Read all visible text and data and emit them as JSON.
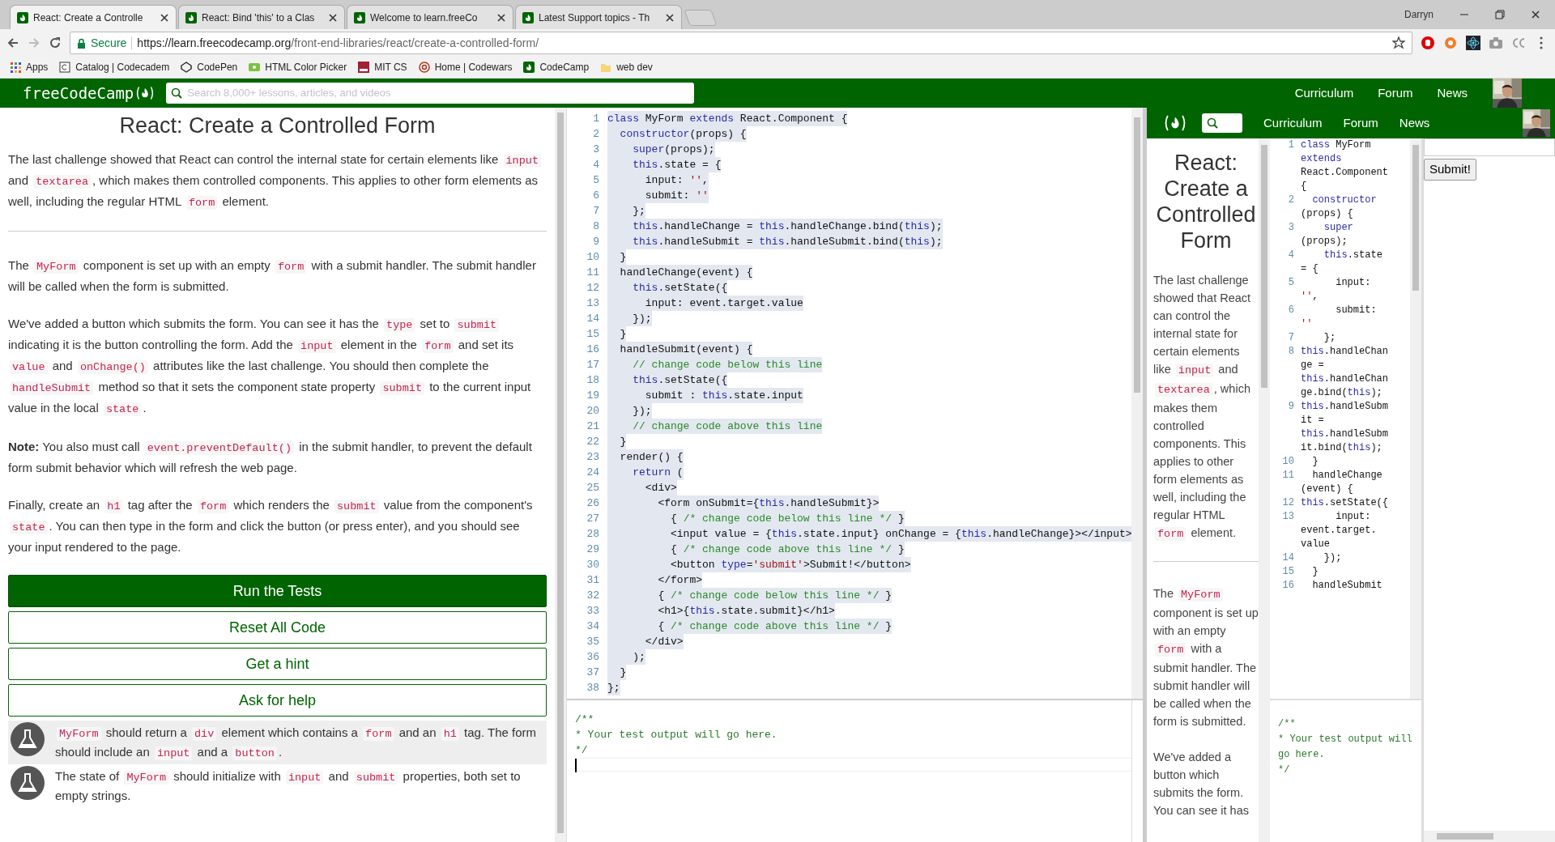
{
  "browser": {
    "tabs": [
      {
        "title": "React: Create a Controlle",
        "selected": true
      },
      {
        "title": "React: Bind 'this' to a Clas",
        "selected": false
      },
      {
        "title": "Welcome to learn.freeCo",
        "selected": false
      },
      {
        "title": "Latest Support topics - Th",
        "selected": false
      }
    ],
    "profile": "Darryn",
    "security": "Secure",
    "url": {
      "host": "https://learn.freecodecamp.org",
      "path": "/front-end-libraries/react/create-a-controlled-form/"
    },
    "bookmarks": [
      {
        "label": "Apps",
        "kind": "apps"
      },
      {
        "label": "Catalog | Codecadem",
        "kind": "codecademy"
      },
      {
        "label": "CodePen",
        "kind": "codepen"
      },
      {
        "label": "HTML Color Picker",
        "kind": "colorpicker"
      },
      {
        "label": "MIT CS",
        "kind": "mit"
      },
      {
        "label": "Home | Codewars",
        "kind": "codewars"
      },
      {
        "label": "CodeCamp",
        "kind": "fcc"
      },
      {
        "label": "web dev",
        "kind": "folder"
      }
    ]
  },
  "site_nav": {
    "logo": "freeCodeCamp",
    "search_placeholder": "Search 8,000+ lessons, articles, and videos",
    "links": [
      "Curriculum",
      "Forum",
      "News"
    ]
  },
  "challenge": {
    "title": "React: Create a Controlled Form",
    "blocks": [
      {
        "kind": "paragraph",
        "segments": [
          {
            "kind": "text",
            "text": "The last challenge showed that React can control the internal state for certain elements like "
          },
          {
            "kind": "code",
            "text": "input"
          },
          {
            "kind": "text",
            "text": " and "
          },
          {
            "kind": "code",
            "text": "textarea"
          },
          {
            "kind": "text",
            "text": ", which makes them controlled components. This applies to other form elements as well, including the regular HTML "
          },
          {
            "kind": "code",
            "text": "form"
          },
          {
            "kind": "text",
            "text": " element."
          }
        ]
      },
      {
        "kind": "divider"
      },
      {
        "kind": "paragraph",
        "segments": [
          {
            "kind": "text",
            "text": "The "
          },
          {
            "kind": "code",
            "text": "MyForm"
          },
          {
            "kind": "text",
            "text": " component is set up with an empty "
          },
          {
            "kind": "code",
            "text": "form"
          },
          {
            "kind": "text",
            "text": " with a submit handler. The submit handler will be called when the form is submitted."
          }
        ]
      },
      {
        "kind": "paragraph",
        "segments": [
          {
            "kind": "text",
            "text": "We've added a button which submits the form. You can see it has the "
          },
          {
            "kind": "code",
            "text": "type"
          },
          {
            "kind": "text",
            "text": " set to "
          },
          {
            "kind": "code",
            "text": "submit"
          },
          {
            "kind": "text",
            "text": " indicating it is the button controlling the form. Add the "
          },
          {
            "kind": "code",
            "text": "input"
          },
          {
            "kind": "text",
            "text": " element in the "
          },
          {
            "kind": "code",
            "text": "form"
          },
          {
            "kind": "text",
            "text": " and set its "
          },
          {
            "kind": "code",
            "text": "value"
          },
          {
            "kind": "text",
            "text": " and "
          },
          {
            "kind": "code",
            "text": "onChange()"
          },
          {
            "kind": "text",
            "text": " attributes like the last challenge. You should then complete the "
          },
          {
            "kind": "code",
            "text": "handleSubmit"
          },
          {
            "kind": "text",
            "text": " method so that it sets the component state property "
          },
          {
            "kind": "code",
            "text": "submit"
          },
          {
            "kind": "text",
            "text": " to the current input value in the local "
          },
          {
            "kind": "code",
            "text": "state"
          },
          {
            "kind": "text",
            "text": "."
          }
        ]
      },
      {
        "kind": "paragraph",
        "segments": [
          {
            "kind": "text",
            "text": "**Note:**  You also must call "
          },
          {
            "kind": "code",
            "text": "event.preventDefault()"
          },
          {
            "kind": "text",
            "text": " in the submit handler, to prevent the default form submit behavior which will refresh the web page."
          }
        ]
      },
      {
        "kind": "paragraph",
        "segments": [
          {
            "kind": "text",
            "text": "Finally, create an "
          },
          {
            "kind": "code",
            "text": "h1"
          },
          {
            "kind": "text",
            "text": " tag after the "
          },
          {
            "kind": "code",
            "text": "form"
          },
          {
            "kind": "text",
            "text": " which renders the "
          },
          {
            "kind": "code",
            "text": "submit"
          },
          {
            "kind": "text",
            "text": " value from the component's "
          },
          {
            "kind": "code",
            "text": "state"
          },
          {
            "kind": "text",
            "text": ". You can then type in the form and click the button (or press enter), and you should see your input rendered to the page."
          }
        ]
      }
    ],
    "buttons": [
      {
        "label": "Run the Tests",
        "kind": "primary"
      },
      {
        "label": "Reset All Code",
        "kind": "outline"
      },
      {
        "label": "Get a hint",
        "kind": "outline"
      },
      {
        "label": "Ask for help",
        "kind": "outline"
      }
    ],
    "tests": [
      {
        "shaded": true,
        "segments": [
          {
            "kind": "code",
            "text": "MyForm"
          },
          {
            "kind": "text",
            "text": " should return a "
          },
          {
            "kind": "code",
            "text": "div"
          },
          {
            "kind": "text",
            "text": " element which contains a "
          },
          {
            "kind": "code",
            "text": "form"
          },
          {
            "kind": "text",
            "text": " and an "
          },
          {
            "kind": "code",
            "text": "h1"
          },
          {
            "kind": "text",
            "text": " tag. The form should include an "
          },
          {
            "kind": "code",
            "text": "input"
          },
          {
            "kind": "text",
            "text": " and a "
          },
          {
            "kind": "code",
            "text": "button"
          },
          {
            "kind": "text",
            "text": "."
          }
        ]
      },
      {
        "shaded": false,
        "segments": [
          {
            "kind": "text",
            "text": "The state of "
          },
          {
            "kind": "code",
            "text": "MyForm"
          },
          {
            "kind": "text",
            "text": " should initialize with "
          },
          {
            "kind": "code",
            "text": "input"
          },
          {
            "kind": "text",
            "text": " and "
          },
          {
            "kind": "code",
            "text": "submit"
          },
          {
            "kind": "text",
            "text": " properties, both set to empty strings."
          }
        ]
      }
    ]
  },
  "editor": {
    "selected": true,
    "lines": [
      {
        "number": "1",
        "tokens": [
          {
            "kind": "keyword",
            "text": "class"
          },
          {
            "kind": "plain",
            "text": " MyForm "
          },
          {
            "kind": "keyword",
            "text": "extends"
          },
          {
            "kind": "plain",
            "text": " React.Component {"
          }
        ]
      },
      {
        "number": "2",
        "tokens": [
          {
            "kind": "keyword",
            "text": "  constructor"
          },
          {
            "kind": "plain",
            "text": "(props) {"
          }
        ]
      },
      {
        "number": "3",
        "tokens": [
          {
            "kind": "keyword",
            "text": "    super"
          },
          {
            "kind": "plain",
            "text": "(props);"
          }
        ]
      },
      {
        "number": "4",
        "tokens": [
          {
            "kind": "keyword",
            "text": "    this"
          },
          {
            "kind": "plain",
            "text": ".state = {"
          }
        ]
      },
      {
        "number": "5",
        "tokens": [
          {
            "kind": "plain",
            "text": "      input: "
          },
          {
            "kind": "string",
            "text": "''"
          },
          {
            "kind": "plain",
            "text": ","
          }
        ]
      },
      {
        "number": "6",
        "tokens": [
          {
            "kind": "plain",
            "text": "      submit: "
          },
          {
            "kind": "string",
            "text": "''"
          }
        ]
      },
      {
        "number": "7",
        "tokens": [
          {
            "kind": "plain",
            "text": "    };"
          }
        ]
      },
      {
        "number": "8",
        "tokens": [
          {
            "kind": "keyword",
            "text": "    this"
          },
          {
            "kind": "plain",
            "text": ".handleChange = "
          },
          {
            "kind": "keyword",
            "text": "this"
          },
          {
            "kind": "plain",
            "text": ".handleChange.bind("
          },
          {
            "kind": "keyword",
            "text": "this"
          },
          {
            "kind": "plain",
            "text": ");"
          }
        ]
      },
      {
        "number": "9",
        "tokens": [
          {
            "kind": "keyword",
            "text": "    this"
          },
          {
            "kind": "plain",
            "text": ".handleSubmit = "
          },
          {
            "kind": "keyword",
            "text": "this"
          },
          {
            "kind": "plain",
            "text": ".handleSubmit.bind("
          },
          {
            "kind": "keyword",
            "text": "this"
          },
          {
            "kind": "plain",
            "text": ");"
          }
        ]
      },
      {
        "number": "10",
        "tokens": [
          {
            "kind": "plain",
            "text": "  }"
          }
        ]
      },
      {
        "number": "11",
        "tokens": [
          {
            "kind": "plain",
            "text": "  handleChange(event) {"
          }
        ]
      },
      {
        "number": "12",
        "tokens": [
          {
            "kind": "keyword",
            "text": "    this"
          },
          {
            "kind": "plain",
            "text": ".setState({"
          }
        ]
      },
      {
        "number": "13",
        "tokens": [
          {
            "kind": "plain",
            "text": "      input: event.target.value"
          }
        ]
      },
      {
        "number": "14",
        "tokens": [
          {
            "kind": "plain",
            "text": "    });"
          }
        ]
      },
      {
        "number": "15",
        "tokens": [
          {
            "kind": "plain",
            "text": "  }"
          }
        ]
      },
      {
        "number": "16",
        "tokens": [
          {
            "kind": "plain",
            "text": "  handleSubmit(event) {"
          }
        ]
      },
      {
        "number": "17",
        "tokens": [
          {
            "kind": "comment",
            "text": "    // change code below this line"
          }
        ]
      },
      {
        "number": "18",
        "tokens": [
          {
            "kind": "keyword",
            "text": "    this"
          },
          {
            "kind": "plain",
            "text": ".setState({"
          }
        ]
      },
      {
        "number": "19",
        "tokens": [
          {
            "kind": "plain",
            "text": "      submit : "
          },
          {
            "kind": "keyword",
            "text": "this"
          },
          {
            "kind": "plain",
            "text": ".state.input"
          }
        ]
      },
      {
        "number": "20",
        "tokens": [
          {
            "kind": "plain",
            "text": "    });"
          }
        ]
      },
      {
        "number": "21",
        "tokens": [
          {
            "kind": "comment",
            "text": "    // change code above this line"
          }
        ]
      },
      {
        "number": "22",
        "tokens": [
          {
            "kind": "plain",
            "text": "  }"
          }
        ]
      },
      {
        "number": "23",
        "tokens": [
          {
            "kind": "plain",
            "text": "  render() {"
          }
        ]
      },
      {
        "number": "24",
        "tokens": [
          {
            "kind": "keyword",
            "text": "    return"
          },
          {
            "kind": "plain",
            "text": " ("
          }
        ]
      },
      {
        "number": "25",
        "tokens": [
          {
            "kind": "plain",
            "text": "      <div>"
          }
        ]
      },
      {
        "number": "26",
        "tokens": [
          {
            "kind": "plain",
            "text": "        <form onSubmit={"
          },
          {
            "kind": "keyword",
            "text": "this"
          },
          {
            "kind": "plain",
            "text": ".handleSubmit}>"
          }
        ]
      },
      {
        "number": "27",
        "tokens": [
          {
            "kind": "plain",
            "text": "          { "
          },
          {
            "kind": "comment",
            "text": "/* change code below this line */"
          },
          {
            "kind": "plain",
            "text": " }"
          }
        ]
      },
      {
        "number": "28",
        "tokens": [
          {
            "kind": "plain",
            "text": "          <input value = {"
          },
          {
            "kind": "keyword",
            "text": "this"
          },
          {
            "kind": "plain",
            "text": ".state.input} onChange = {"
          },
          {
            "kind": "keyword",
            "text": "this"
          },
          {
            "kind": "plain",
            "text": ".handleChange}></input>"
          }
        ]
      },
      {
        "number": "29",
        "tokens": [
          {
            "kind": "plain",
            "text": "          { "
          },
          {
            "kind": "comment",
            "text": "/* change code above this line */"
          },
          {
            "kind": "plain",
            "text": " }"
          }
        ]
      },
      {
        "number": "30",
        "tokens": [
          {
            "kind": "plain",
            "text": "          <button "
          },
          {
            "kind": "keyword",
            "text": "type"
          },
          {
            "kind": "plain",
            "text": "="
          },
          {
            "kind": "string",
            "text": "'submit'"
          },
          {
            "kind": "plain",
            "text": ">Submit!</button>"
          }
        ]
      },
      {
        "number": "31",
        "tokens": [
          {
            "kind": "plain",
            "text": "        </form>"
          }
        ]
      },
      {
        "number": "32",
        "tokens": [
          {
            "kind": "plain",
            "text": "        { "
          },
          {
            "kind": "comment",
            "text": "/* change code below this line */"
          },
          {
            "kind": "plain",
            "text": " }"
          }
        ]
      },
      {
        "number": "33",
        "tokens": [
          {
            "kind": "plain",
            "text": "        <h1>{"
          },
          {
            "kind": "keyword",
            "text": "this"
          },
          {
            "kind": "plain",
            "text": ".state.submit}</h1>"
          }
        ]
      },
      {
        "number": "34",
        "tokens": [
          {
            "kind": "plain",
            "text": "        { "
          },
          {
            "kind": "comment",
            "text": "/* change code above this line */"
          },
          {
            "kind": "plain",
            "text": " }"
          }
        ]
      },
      {
        "number": "35",
        "tokens": [
          {
            "kind": "plain",
            "text": "      </div>"
          }
        ]
      },
      {
        "number": "36",
        "tokens": [
          {
            "kind": "plain",
            "text": "    );"
          }
        ]
      },
      {
        "number": "37",
        "tokens": [
          {
            "kind": "plain",
            "text": "  }"
          }
        ]
      },
      {
        "number": "38",
        "tokens": [
          {
            "kind": "plain",
            "text": "};"
          }
        ]
      }
    ]
  },
  "output": {
    "lines": [
      "/**",
      "* Your test output will go here.",
      "*/"
    ]
  },
  "preview": {
    "nav_links": [
      "Curriculum",
      "Forum",
      "News"
    ],
    "title": "React: Create a Controlled Form",
    "blocks": [
      {
        "kind": "paragraph",
        "segments": [
          {
            "kind": "text",
            "text": "The last challenge showed that React can control the internal state for certain elements like "
          },
          {
            "kind": "code",
            "text": "input"
          },
          {
            "kind": "text",
            "text": " and "
          },
          {
            "kind": "code",
            "text": "textarea"
          },
          {
            "kind": "text",
            "text": ", which makes them controlled components. This applies to other form elements as well, including the regular HTML "
          },
          {
            "kind": "code",
            "text": "form"
          },
          {
            "kind": "text",
            "text": " element."
          }
        ]
      },
      {
        "kind": "divider"
      },
      {
        "kind": "paragraph",
        "segments": [
          {
            "kind": "text",
            "text": "The "
          },
          {
            "kind": "code",
            "text": "MyForm"
          },
          {
            "kind": "text",
            "text": " component is set up with an empty "
          },
          {
            "kind": "code",
            "text": "form"
          },
          {
            "kind": "text",
            "text": " with a submit handler. The submit handler will be called when the form is submitted."
          }
        ]
      },
      {
        "kind": "paragraph",
        "segments": [
          {
            "kind": "text",
            "text": "We've added a button which submits the form. You can see it has"
          }
        ]
      }
    ],
    "code_lines": [
      {
        "number": "1",
        "tokens": [
          {
            "kind": "keyword",
            "text": "class"
          },
          {
            "kind": "plain",
            "text": " MyForm "
          },
          {
            "kind": "keyword",
            "text": "extends"
          },
          {
            "kind": "plain",
            "text": " React.Component {"
          }
        ]
      },
      {
        "number": "2",
        "tokens": [
          {
            "kind": "keyword",
            "text": "  constructor"
          },
          {
            "kind": "plain",
            "text": " (props) {"
          }
        ]
      },
      {
        "number": "3",
        "tokens": [
          {
            "kind": "keyword",
            "text": "    super"
          },
          {
            "kind": "plain",
            "text": " (props);"
          }
        ]
      },
      {
        "number": "4",
        "tokens": [
          {
            "kind": "keyword",
            "text": "    this"
          },
          {
            "kind": "plain",
            "text": ".state = {"
          }
        ]
      },
      {
        "number": "5",
        "tokens": [
          {
            "kind": "plain",
            "text": "      input: "
          },
          {
            "kind": "string",
            "text": "''"
          },
          {
            "kind": "plain",
            "text": ","
          }
        ]
      },
      {
        "number": "6",
        "tokens": [
          {
            "kind": "plain",
            "text": "      submit: "
          },
          {
            "kind": "string",
            "text": "''"
          }
        ]
      },
      {
        "number": "7",
        "tokens": [
          {
            "kind": "plain",
            "text": "    };"
          }
        ]
      },
      {
        "number": "8",
        "tokens": [
          {
            "kind": "keyword",
            "text": "this"
          },
          {
            "kind": "plain",
            "text": ".handleChange = "
          },
          {
            "kind": "keyword",
            "text": "this"
          },
          {
            "kind": "plain",
            "text": ".handleChange.bind("
          },
          {
            "kind": "keyword",
            "text": "this"
          },
          {
            "kind": "plain",
            "text": ");"
          }
        ]
      },
      {
        "number": "9",
        "tokens": [
          {
            "kind": "keyword",
            "text": "this"
          },
          {
            "kind": "plain",
            "text": ".handleSubmit = "
          },
          {
            "kind": "keyword",
            "text": "this"
          },
          {
            "kind": "plain",
            "text": ".handleSubmit.bind("
          },
          {
            "kind": "keyword",
            "text": "this"
          },
          {
            "kind": "plain",
            "text": ");"
          }
        ]
      },
      {
        "number": "10",
        "tokens": [
          {
            "kind": "plain",
            "text": "  }"
          }
        ]
      },
      {
        "number": "11",
        "tokens": [
          {
            "kind": "plain",
            "text": "  handleChange (event) {"
          }
        ]
      },
      {
        "number": "12",
        "tokens": [
          {
            "kind": "keyword",
            "text": "this"
          },
          {
            "kind": "plain",
            "text": ".setState({"
          }
        ]
      },
      {
        "number": "13",
        "tokens": [
          {
            "kind": "plain",
            "text": "      input: event.target. value"
          }
        ]
      },
      {
        "number": "14",
        "tokens": [
          {
            "kind": "plain",
            "text": "    });"
          }
        ]
      },
      {
        "number": "15",
        "tokens": [
          {
            "kind": "plain",
            "text": "  }"
          }
        ]
      },
      {
        "number": "16",
        "tokens": [
          {
            "kind": "plain",
            "text": "  handleSubmit"
          }
        ]
      }
    ],
    "output_lines": [
      "/**",
      "* Your test output will go here.",
      "*/"
    ],
    "submit_button": "Submit!"
  }
}
